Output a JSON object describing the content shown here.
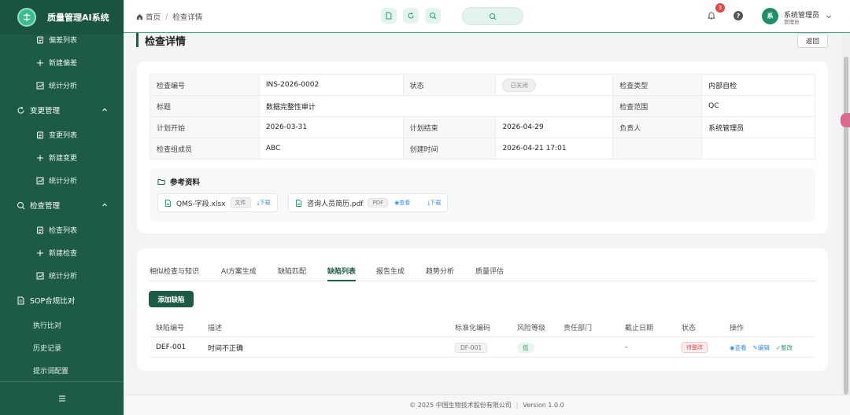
{
  "app": {
    "title": "质量管理AI系统"
  },
  "sidebar": {
    "items": [
      {
        "type": "sub",
        "label": "偏差列表",
        "icon": "list-icon"
      },
      {
        "type": "sub",
        "label": "新建偏差",
        "icon": "plus-icon"
      },
      {
        "type": "sub",
        "label": "统计分析",
        "icon": "chart-icon"
      },
      {
        "type": "group",
        "label": "变更管理",
        "icon": "refresh-icon"
      },
      {
        "type": "sub",
        "label": "变更列表",
        "icon": "list-icon"
      },
      {
        "type": "sub",
        "label": "新建变更",
        "icon": "plus-icon"
      },
      {
        "type": "sub",
        "label": "统计分析",
        "icon": "chart-icon"
      },
      {
        "type": "group",
        "label": "检查管理",
        "icon": "search-icon"
      },
      {
        "type": "sub",
        "label": "检查列表",
        "icon": "list-icon"
      },
      {
        "type": "sub",
        "label": "新建检查",
        "icon": "plus-icon"
      },
      {
        "type": "sub",
        "label": "统计分析",
        "icon": "chart-icon"
      },
      {
        "type": "group",
        "label": "SOP合规比对",
        "icon": "document-icon"
      },
      {
        "type": "plain",
        "label": "执行比对"
      },
      {
        "type": "plain",
        "label": "历史记录"
      },
      {
        "type": "plain",
        "label": "提示词配置"
      }
    ]
  },
  "header": {
    "breadcrumb": [
      "首页",
      "检查详情"
    ],
    "notification_count": "3",
    "help_glyph": "?",
    "user": {
      "avatar_text": "系",
      "name": "系统管理员",
      "role": "管理员"
    }
  },
  "page": {
    "title": "检查详情",
    "back_label": "返回"
  },
  "info": {
    "rows": [
      [
        {
          "k": "检查编号",
          "v": "INS-2026-0002"
        },
        {
          "k": "状态",
          "v": "已关闭",
          "tag": true
        },
        {
          "k": "检查类型",
          "v": "内部自检"
        }
      ],
      [
        {
          "k": "标题",
          "v": "数据完整性审计",
          "wide": true
        },
        {
          "k": "检查范围",
          "v": "QC"
        }
      ],
      [
        {
          "k": "计划开始",
          "v": "2026-03-31"
        },
        {
          "k": "计划结束",
          "v": "2026-04-29"
        },
        {
          "k": "负责人",
          "v": "系统管理员"
        }
      ],
      [
        {
          "k": "检查组成员",
          "v": "ABC"
        },
        {
          "k": "创建时间",
          "v": "2026-04-21 17:01"
        },
        {
          "k": "",
          "v": ""
        }
      ]
    ]
  },
  "references": {
    "title": "参考资料",
    "files": [
      {
        "name": "QMS-字段.xlsx",
        "tag": "文件",
        "links": [
          "下载"
        ]
      },
      {
        "name": "咨询人员简历.pdf",
        "tag": "PDF",
        "links": [
          "查看",
          "下载"
        ]
      }
    ]
  },
  "tabs": [
    "相似检查与知识",
    "AI方案生成",
    "缺陷匹配",
    "缺陷列表",
    "报告生成",
    "趋势分析",
    "质量评估"
  ],
  "active_tab": "缺陷列表",
  "defects": {
    "add_label": "添加缺陷",
    "columns": [
      "缺陷编号",
      "描述",
      "标准化编码",
      "风险等级",
      "责任部门",
      "截止日期",
      "状态",
      "操作"
    ],
    "rows": [
      {
        "id": "DEF-001",
        "desc": "时间不正确",
        "code": "DF-001",
        "risk": "低",
        "dept": "",
        "due": "-",
        "status": "待整改",
        "actions": [
          "查看",
          "编辑",
          "整改"
        ]
      }
    ]
  },
  "footer": {
    "copyright": "© 2025 中国生物技术股份有限公司",
    "version": "Version 1.0.0"
  },
  "colors": {
    "primary": "#1d5b45",
    "accent": "#3b9d79",
    "danger": "#e24a4a",
    "link": "#3a8ee6"
  }
}
